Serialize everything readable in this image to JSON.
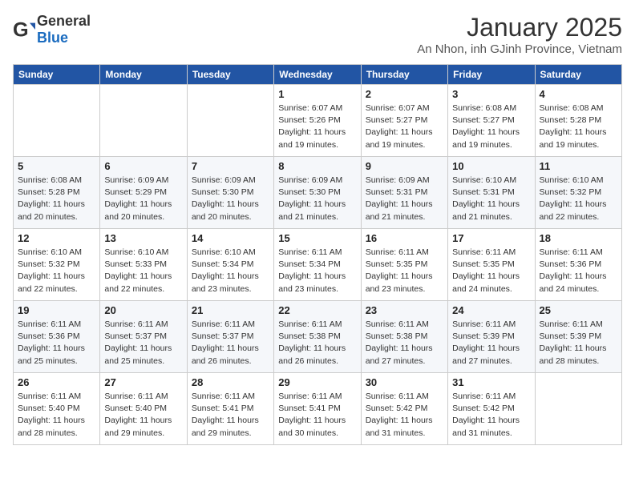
{
  "logo": {
    "general": "General",
    "blue": "Blue"
  },
  "title": "January 2025",
  "subtitle": "An Nhon, inh GJinh Province, Vietnam",
  "days_of_week": [
    "Sunday",
    "Monday",
    "Tuesday",
    "Wednesday",
    "Thursday",
    "Friday",
    "Saturday"
  ],
  "weeks": [
    [
      {
        "day": "",
        "sunrise": "",
        "sunset": "",
        "daylight": ""
      },
      {
        "day": "",
        "sunrise": "",
        "sunset": "",
        "daylight": ""
      },
      {
        "day": "",
        "sunrise": "",
        "sunset": "",
        "daylight": ""
      },
      {
        "day": "1",
        "sunrise": "Sunrise: 6:07 AM",
        "sunset": "Sunset: 5:26 PM",
        "daylight": "Daylight: 11 hours and 19 minutes."
      },
      {
        "day": "2",
        "sunrise": "Sunrise: 6:07 AM",
        "sunset": "Sunset: 5:27 PM",
        "daylight": "Daylight: 11 hours and 19 minutes."
      },
      {
        "day": "3",
        "sunrise": "Sunrise: 6:08 AM",
        "sunset": "Sunset: 5:27 PM",
        "daylight": "Daylight: 11 hours and 19 minutes."
      },
      {
        "day": "4",
        "sunrise": "Sunrise: 6:08 AM",
        "sunset": "Sunset: 5:28 PM",
        "daylight": "Daylight: 11 hours and 19 minutes."
      }
    ],
    [
      {
        "day": "5",
        "sunrise": "Sunrise: 6:08 AM",
        "sunset": "Sunset: 5:28 PM",
        "daylight": "Daylight: 11 hours and 20 minutes."
      },
      {
        "day": "6",
        "sunrise": "Sunrise: 6:09 AM",
        "sunset": "Sunset: 5:29 PM",
        "daylight": "Daylight: 11 hours and 20 minutes."
      },
      {
        "day": "7",
        "sunrise": "Sunrise: 6:09 AM",
        "sunset": "Sunset: 5:30 PM",
        "daylight": "Daylight: 11 hours and 20 minutes."
      },
      {
        "day": "8",
        "sunrise": "Sunrise: 6:09 AM",
        "sunset": "Sunset: 5:30 PM",
        "daylight": "Daylight: 11 hours and 21 minutes."
      },
      {
        "day": "9",
        "sunrise": "Sunrise: 6:09 AM",
        "sunset": "Sunset: 5:31 PM",
        "daylight": "Daylight: 11 hours and 21 minutes."
      },
      {
        "day": "10",
        "sunrise": "Sunrise: 6:10 AM",
        "sunset": "Sunset: 5:31 PM",
        "daylight": "Daylight: 11 hours and 21 minutes."
      },
      {
        "day": "11",
        "sunrise": "Sunrise: 6:10 AM",
        "sunset": "Sunset: 5:32 PM",
        "daylight": "Daylight: 11 hours and 22 minutes."
      }
    ],
    [
      {
        "day": "12",
        "sunrise": "Sunrise: 6:10 AM",
        "sunset": "Sunset: 5:32 PM",
        "daylight": "Daylight: 11 hours and 22 minutes."
      },
      {
        "day": "13",
        "sunrise": "Sunrise: 6:10 AM",
        "sunset": "Sunset: 5:33 PM",
        "daylight": "Daylight: 11 hours and 22 minutes."
      },
      {
        "day": "14",
        "sunrise": "Sunrise: 6:10 AM",
        "sunset": "Sunset: 5:34 PM",
        "daylight": "Daylight: 11 hours and 23 minutes."
      },
      {
        "day": "15",
        "sunrise": "Sunrise: 6:11 AM",
        "sunset": "Sunset: 5:34 PM",
        "daylight": "Daylight: 11 hours and 23 minutes."
      },
      {
        "day": "16",
        "sunrise": "Sunrise: 6:11 AM",
        "sunset": "Sunset: 5:35 PM",
        "daylight": "Daylight: 11 hours and 23 minutes."
      },
      {
        "day": "17",
        "sunrise": "Sunrise: 6:11 AM",
        "sunset": "Sunset: 5:35 PM",
        "daylight": "Daylight: 11 hours and 24 minutes."
      },
      {
        "day": "18",
        "sunrise": "Sunrise: 6:11 AM",
        "sunset": "Sunset: 5:36 PM",
        "daylight": "Daylight: 11 hours and 24 minutes."
      }
    ],
    [
      {
        "day": "19",
        "sunrise": "Sunrise: 6:11 AM",
        "sunset": "Sunset: 5:36 PM",
        "daylight": "Daylight: 11 hours and 25 minutes."
      },
      {
        "day": "20",
        "sunrise": "Sunrise: 6:11 AM",
        "sunset": "Sunset: 5:37 PM",
        "daylight": "Daylight: 11 hours and 25 minutes."
      },
      {
        "day": "21",
        "sunrise": "Sunrise: 6:11 AM",
        "sunset": "Sunset: 5:37 PM",
        "daylight": "Daylight: 11 hours and 26 minutes."
      },
      {
        "day": "22",
        "sunrise": "Sunrise: 6:11 AM",
        "sunset": "Sunset: 5:38 PM",
        "daylight": "Daylight: 11 hours and 26 minutes."
      },
      {
        "day": "23",
        "sunrise": "Sunrise: 6:11 AM",
        "sunset": "Sunset: 5:38 PM",
        "daylight": "Daylight: 11 hours and 27 minutes."
      },
      {
        "day": "24",
        "sunrise": "Sunrise: 6:11 AM",
        "sunset": "Sunset: 5:39 PM",
        "daylight": "Daylight: 11 hours and 27 minutes."
      },
      {
        "day": "25",
        "sunrise": "Sunrise: 6:11 AM",
        "sunset": "Sunset: 5:39 PM",
        "daylight": "Daylight: 11 hours and 28 minutes."
      }
    ],
    [
      {
        "day": "26",
        "sunrise": "Sunrise: 6:11 AM",
        "sunset": "Sunset: 5:40 PM",
        "daylight": "Daylight: 11 hours and 28 minutes."
      },
      {
        "day": "27",
        "sunrise": "Sunrise: 6:11 AM",
        "sunset": "Sunset: 5:40 PM",
        "daylight": "Daylight: 11 hours and 29 minutes."
      },
      {
        "day": "28",
        "sunrise": "Sunrise: 6:11 AM",
        "sunset": "Sunset: 5:41 PM",
        "daylight": "Daylight: 11 hours and 29 minutes."
      },
      {
        "day": "29",
        "sunrise": "Sunrise: 6:11 AM",
        "sunset": "Sunset: 5:41 PM",
        "daylight": "Daylight: 11 hours and 30 minutes."
      },
      {
        "day": "30",
        "sunrise": "Sunrise: 6:11 AM",
        "sunset": "Sunset: 5:42 PM",
        "daylight": "Daylight: 11 hours and 31 minutes."
      },
      {
        "day": "31",
        "sunrise": "Sunrise: 6:11 AM",
        "sunset": "Sunset: 5:42 PM",
        "daylight": "Daylight: 11 hours and 31 minutes."
      },
      {
        "day": "",
        "sunrise": "",
        "sunset": "",
        "daylight": ""
      }
    ]
  ]
}
